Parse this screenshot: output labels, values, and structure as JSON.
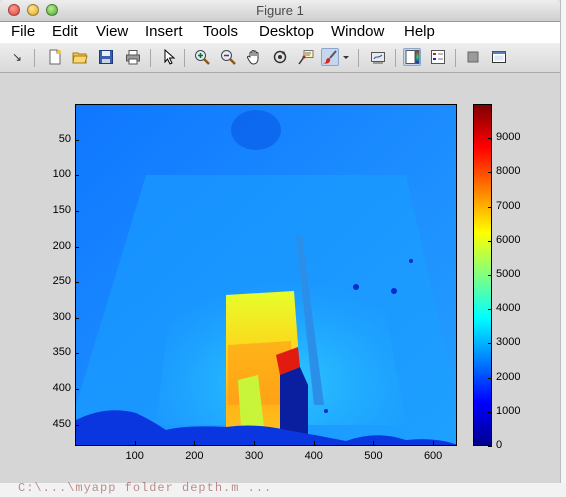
{
  "window": {
    "title": "Figure 1"
  },
  "menu": [
    "File",
    "Edit",
    "View",
    "Insert",
    "Tools",
    "Desktop",
    "Window",
    "Help"
  ],
  "toolbar": [
    {
      "name": "dock-arrow-icon",
      "glyph": "↘"
    },
    {
      "name": "new-figure-icon"
    },
    {
      "name": "open-file-icon"
    },
    {
      "name": "save-icon"
    },
    {
      "name": "print-icon"
    },
    {
      "name": "edit-plot-arrow-icon"
    },
    {
      "name": "zoom-in-icon"
    },
    {
      "name": "zoom-out-icon"
    },
    {
      "name": "pan-hand-icon"
    },
    {
      "name": "rotate-3d-icon"
    },
    {
      "name": "data-cursor-icon"
    },
    {
      "name": "brush-icon"
    },
    {
      "name": "brush-dropdown-icon"
    },
    {
      "name": "link-plot-icon"
    },
    {
      "name": "colorbar-icon"
    },
    {
      "name": "legend-icon"
    },
    {
      "name": "hide-plot-tools-icon"
    },
    {
      "name": "show-plot-tools-icon"
    }
  ],
  "chart_data": {
    "type": "heatmap",
    "title": "",
    "xlabel": "",
    "ylabel": "",
    "x_ticks": [
      100,
      200,
      300,
      400,
      500,
      600
    ],
    "y_ticks": [
      50,
      100,
      150,
      200,
      250,
      300,
      350,
      400,
      450
    ],
    "xlim": [
      0,
      640
    ],
    "ylim": [
      0,
      480
    ],
    "y_direction": "reversed",
    "colormap": "jet",
    "clim": [
      0,
      10000
    ],
    "colorbar_ticks": [
      0,
      1000,
      2000,
      3000,
      4000,
      5000,
      6000,
      7000,
      8000,
      9000
    ],
    "regions": [
      {
        "desc": "background wall",
        "approx_value": 2300
      },
      {
        "desc": "upper area",
        "approx_value": 1900
      },
      {
        "desc": "bright door/panel center x~310 y~270-450",
        "approx_value": 6500
      },
      {
        "desc": "red patch near x~370 y~350",
        "approx_value": 9000
      },
      {
        "desc": "dark blue floor / lower objects",
        "approx_value": 800
      }
    ]
  },
  "desktop": {
    "text": "C:\\...\\myapp  folder  depth.m  ..."
  },
  "colors": {
    "titlebar": "#dcdcdc",
    "figure_bg": "#d6d6d6",
    "menu_bg": "#ffffff"
  }
}
